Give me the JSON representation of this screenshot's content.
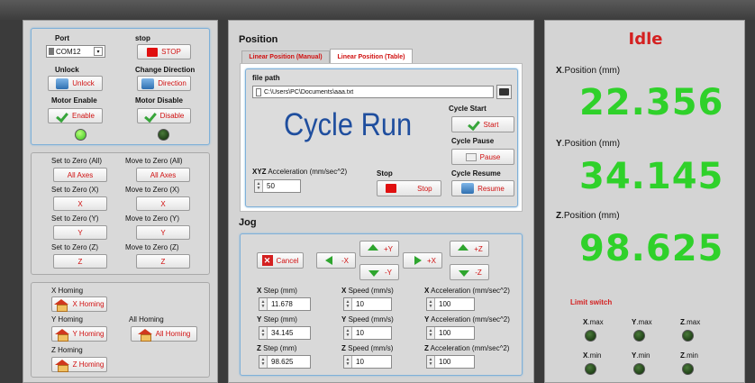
{
  "connection": {
    "port_label": "Port",
    "port_value": "COM12",
    "stop_label": "stop",
    "stop_button": "STOP",
    "unlock_label": "Unlock",
    "unlock_button": "Unlock",
    "direction_label": "Change Direction",
    "direction_button": "Direction",
    "enable_label": "Motor Enable",
    "enable_button": "Enable",
    "disable_label": "Motor Disable",
    "disable_button": "Disable"
  },
  "zero": {
    "set_all_label": "Set to Zero (All)",
    "move_all_label": "Move to Zero (All)",
    "set_all_button": "All Axes",
    "move_all_button": "All Axes",
    "set_x_label": "Set to Zero (X)",
    "move_x_label": "Move to Zero (X)",
    "set_x_button": "X",
    "move_x_button": "X",
    "set_y_label": "Set to Zero (Y)",
    "move_y_label": "Move to Zero (Y)",
    "set_y_button": "Y",
    "move_y_button": "Y",
    "set_z_label": "Set to Zero (Z)",
    "move_z_label": "Move to Zero (Z)",
    "set_z_button": "Z",
    "move_z_button": "Z"
  },
  "homing": {
    "x_label": "X Homing",
    "x_button": "X Homing",
    "y_label": "Y Homing",
    "y_button": "Y Homing",
    "all_label": "All Homing",
    "all_button": "All Homing",
    "z_label": "Z Homing",
    "z_button": "Z Homing"
  },
  "position": {
    "title": "Position",
    "tabs": [
      "Linear Position (Manual)",
      "Linear Position (Table)"
    ],
    "file_path_label": "file path",
    "file_path_value": "C:\\Users\\PC\\Documents\\aaa.txt",
    "cycle_text": "Cycle Run",
    "cycle_start_label": "Cycle Start",
    "start_button": "Start",
    "cycle_pause_label": "Cycle Pause",
    "pause_button": "Pause",
    "accel_label_axes": "XYZ",
    "accel_label": "Acceleration (mm/sec^2)",
    "accel_value": "50",
    "stop_label": "Stop",
    "stop_button": "Stop",
    "cycle_resume_label": "Cycle Resume",
    "resume_button": "Resume"
  },
  "jog": {
    "title": "Jog",
    "cancel": "Cancel",
    "minus_x": "-X",
    "plus_x": "+X",
    "plus_y": "+Y",
    "minus_y": "-Y",
    "plus_z": "+Z",
    "minus_z": "-Z",
    "x_step_axis": "X",
    "x_step_label": "Step (mm)",
    "x_step": "11.678",
    "x_speed_axis": "X",
    "x_speed_label": "Speed (mm/s)",
    "x_speed": "10",
    "x_acc_axis": "X",
    "x_acc_label": "Acceleration (mm/sec^2)",
    "x_acc": "100",
    "y_step_axis": "Y",
    "y_step_label": "Step (mm)",
    "y_step": "34.145",
    "y_speed_axis": "Y",
    "y_speed_label": "Speed (mm/s)",
    "y_speed": "10",
    "y_acc_axis": "Y",
    "y_acc_label": "Acceleration (mm/sec^2)",
    "y_acc": "100",
    "z_step_axis": "Z",
    "z_step_label": "Step (mm)",
    "z_step": "98.625",
    "z_speed_axis": "Z",
    "z_speed_label": "Speed (mm/s)",
    "z_speed": "10",
    "z_acc_axis": "Z",
    "z_acc_label": "Acceleration (mm/sec^2)",
    "z_acc": "100"
  },
  "status": {
    "state": "Idle",
    "x_axis": "X",
    "x_label": ".Position (mm)",
    "x_value": "22.356",
    "y_axis": "Y",
    "y_label": ".Position (mm)",
    "y_value": "34.145",
    "z_axis": "Z",
    "z_label": ".Position (mm)",
    "z_value": "98.625",
    "limit_title": "Limit switch",
    "xmax_axis": "X",
    "xmax_suffix": ".max",
    "ymax_axis": "Y",
    "ymax_suffix": ".max",
    "zmax_axis": "Z",
    "zmax_suffix": ".max",
    "xmin_axis": "X",
    "xmin_suffix": ".min",
    "ymin_axis": "Y",
    "ymin_suffix": ".min",
    "zmin_axis": "Z",
    "zmin_suffix": ".min"
  },
  "colors": {
    "digits": "#2fd12a",
    "state": "#d42020",
    "accent_border": "#7fb0d8",
    "button_text": "#d01010"
  }
}
